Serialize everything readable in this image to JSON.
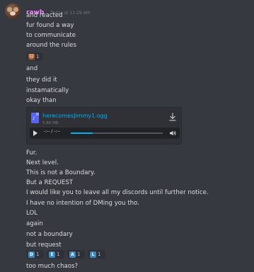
{
  "message": {
    "username": "rawb",
    "timestamp": "Today at 11:29 AM",
    "text_lines_before_reaction": [
      "and reacted",
      "fur found a way",
      "to communicate",
      "around the rules"
    ],
    "reaction_1": {
      "emoji": "cat-face-icon",
      "count": "1"
    },
    "text_lines_before_attachment": [
      "and",
      "they did it",
      "instamatically",
      "okay than"
    ],
    "attachment": {
      "file_name": "herecomesJimmy1.ogg",
      "file_size": "5.86 MB",
      "icon": "audio-file-icon",
      "download_icon": "download-icon",
      "player": {
        "time": "-:-- / -:--",
        "play_icon": "play-icon",
        "volume_icon": "volume-icon",
        "progress": 0.24
      }
    },
    "text_lines_after_attachment": [
      "Fur.",
      "Next level.",
      "This is not a Boundary.",
      "But a REQUEST",
      "I would like you to leave all my discords until further notice.",
      "I have no intention of DMing you tho.",
      "LOL",
      "again",
      "not a boundary",
      "but request"
    ],
    "letter_reactions": [
      {
        "letter": "D",
        "count": "1"
      },
      {
        "letter": "E",
        "count": "1"
      },
      {
        "letter": "A",
        "count": "1"
      },
      {
        "letter": "L",
        "count": "1"
      }
    ],
    "final_line": "too much chaos?"
  },
  "colors": {
    "background": "#36393f",
    "username": "#f47fff",
    "link": "#00aff4",
    "reaction_bg": "#2f3136",
    "letter_reaction": "#3b88c3"
  }
}
